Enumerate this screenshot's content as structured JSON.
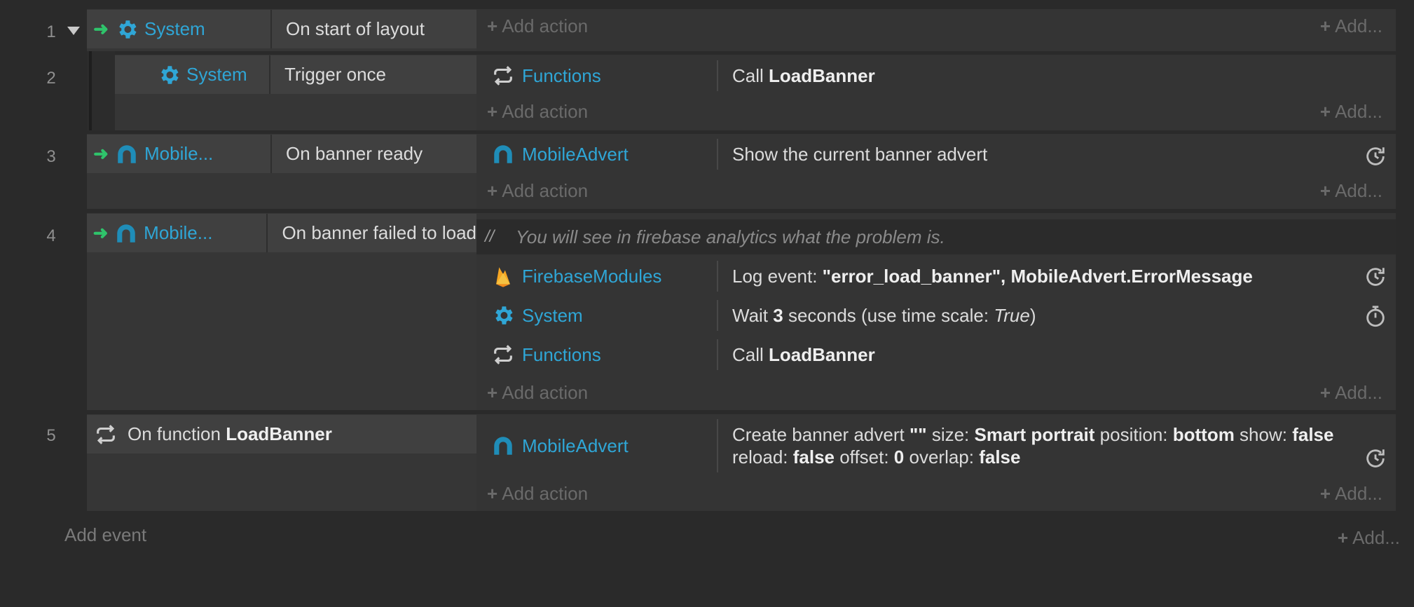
{
  "events": [
    {
      "num": "1",
      "conditions": [
        {
          "object": "System",
          "text": "On start of layout"
        }
      ],
      "add_action": "Add action",
      "add_more": "Add..."
    },
    {
      "num": "2",
      "conditions": [
        {
          "object": "System",
          "text": "Trigger once"
        }
      ],
      "actions": [
        {
          "object": "Functions",
          "pre": "Call ",
          "bold": "LoadBanner"
        }
      ],
      "add_action": "Add action",
      "add_more": "Add..."
    },
    {
      "num": "3",
      "conditions": [
        {
          "object": "Mobile...",
          "text": "On banner ready"
        }
      ],
      "actions": [
        {
          "object": "MobileAdvert",
          "text": "Show the current banner advert"
        }
      ],
      "add_action": "Add action",
      "add_more": "Add..."
    },
    {
      "num": "4",
      "conditions": [
        {
          "object": "Mobile...",
          "text": "On banner failed to load"
        }
      ],
      "comment_mark": "//",
      "comment": "You will see in firebase analytics what the problem is.",
      "actions": [
        {
          "object": "FirebaseModules",
          "pre": "Log event: ",
          "bold": "\"error_load_banner\", MobileAdvert.ErrorMessage"
        },
        {
          "object": "System",
          "pre": "Wait ",
          "bold": "3",
          "mid": " seconds (use time scale: ",
          "italic": "True",
          "post": ")"
        },
        {
          "object": "Functions",
          "pre": "Call ",
          "bold": "LoadBanner"
        }
      ],
      "add_action": "Add action",
      "add_more": "Add..."
    },
    {
      "num": "5",
      "conditions": [
        {
          "pre": "On function ",
          "bold": "LoadBanner"
        }
      ],
      "actions": [
        {
          "object": "MobileAdvert",
          "line1": {
            "a": "Create banner advert ",
            "b": "\"\"",
            "c": " size: ",
            "d": "Smart portrait",
            "e": " position: ",
            "f": "bottom",
            "g": " show: ",
            "h": "false"
          },
          "line2": {
            "a": "reload: ",
            "b": "false",
            "c": " offset: ",
            "d": "0",
            "e": " overlap: ",
            "f": "false"
          }
        }
      ],
      "add_action": "Add action",
      "add_more": "Add..."
    }
  ],
  "footer": {
    "add_event": "Add event",
    "add_more": "Add..."
  },
  "colors": {
    "background": "#2a2a2a",
    "object_link": "#2fa6d6",
    "trigger_arrow": "#2fc46b",
    "muted": "#6a6a6a"
  },
  "icons": [
    "gear-icon",
    "mobile-advert-icon",
    "functions-loop-icon",
    "firebase-flame-icon",
    "reset-icon",
    "timer-icon",
    "triangle-collapse-icon",
    "trigger-arrow-icon",
    "plus-icon"
  ]
}
